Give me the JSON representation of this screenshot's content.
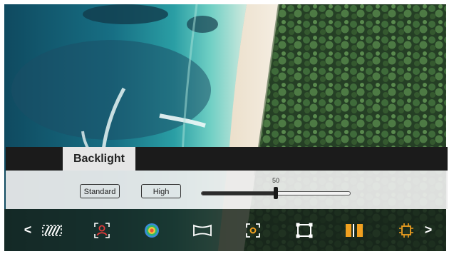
{
  "panel": {
    "active_tab_label": "Backlight"
  },
  "backlight": {
    "modes": [
      {
        "label": "Standard"
      },
      {
        "label": "High"
      }
    ],
    "slider": {
      "value": "50",
      "fraction": 0.5
    }
  },
  "toolbar": {
    "prev_label": "<",
    "next_label": ">",
    "items": [
      {
        "icon": "backlight-stripes-icon"
      },
      {
        "icon": "face-detect-icon"
      },
      {
        "icon": "color-wheel-icon"
      },
      {
        "icon": "keystone-icon"
      },
      {
        "icon": "focus-icon"
      },
      {
        "icon": "frame-icon"
      },
      {
        "icon": "split-bars-icon"
      },
      {
        "icon": "crop-icon"
      }
    ]
  },
  "colors": {
    "accent": "#f0a020",
    "face_icon": "#e23a3a"
  }
}
